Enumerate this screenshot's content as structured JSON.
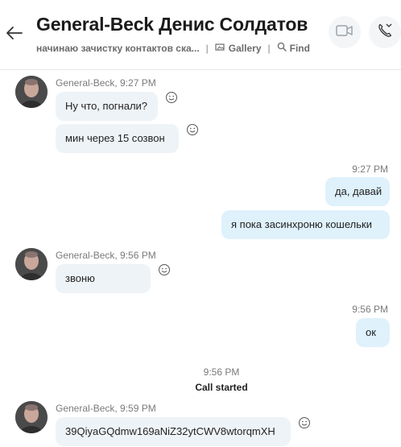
{
  "header": {
    "title": "General-Beck Денис Солдатов",
    "mood": "начинаю зачистку контактов ска...",
    "separator": "|",
    "gallery_label": "Gallery",
    "find_label": "Find"
  },
  "messages": {
    "m1": {
      "sender": "General-Beck, 9:27 PM",
      "lines": [
        "Ну что, погнали?",
        "мин через 15 созвон"
      ]
    },
    "m2": {
      "time": "9:27 PM",
      "lines": [
        "да, давай",
        "я пока засинхроню кошельки"
      ]
    },
    "m3": {
      "sender": "General-Beck, 9:56 PM",
      "lines": [
        "звоню"
      ]
    },
    "m4": {
      "time": "9:56 PM",
      "lines": [
        "ок"
      ]
    },
    "call": {
      "time": "9:56 PM",
      "label": "Call started"
    },
    "m5": {
      "sender": "General-Beck, 9:59 PM",
      "lines": [
        "39QiyaGQdmw169aNiZ32ytCWV8wtorqmXH"
      ]
    }
  },
  "colors": {
    "incoming_bubble": "#eef3f7",
    "outgoing_bubble": "#dff1fb"
  }
}
